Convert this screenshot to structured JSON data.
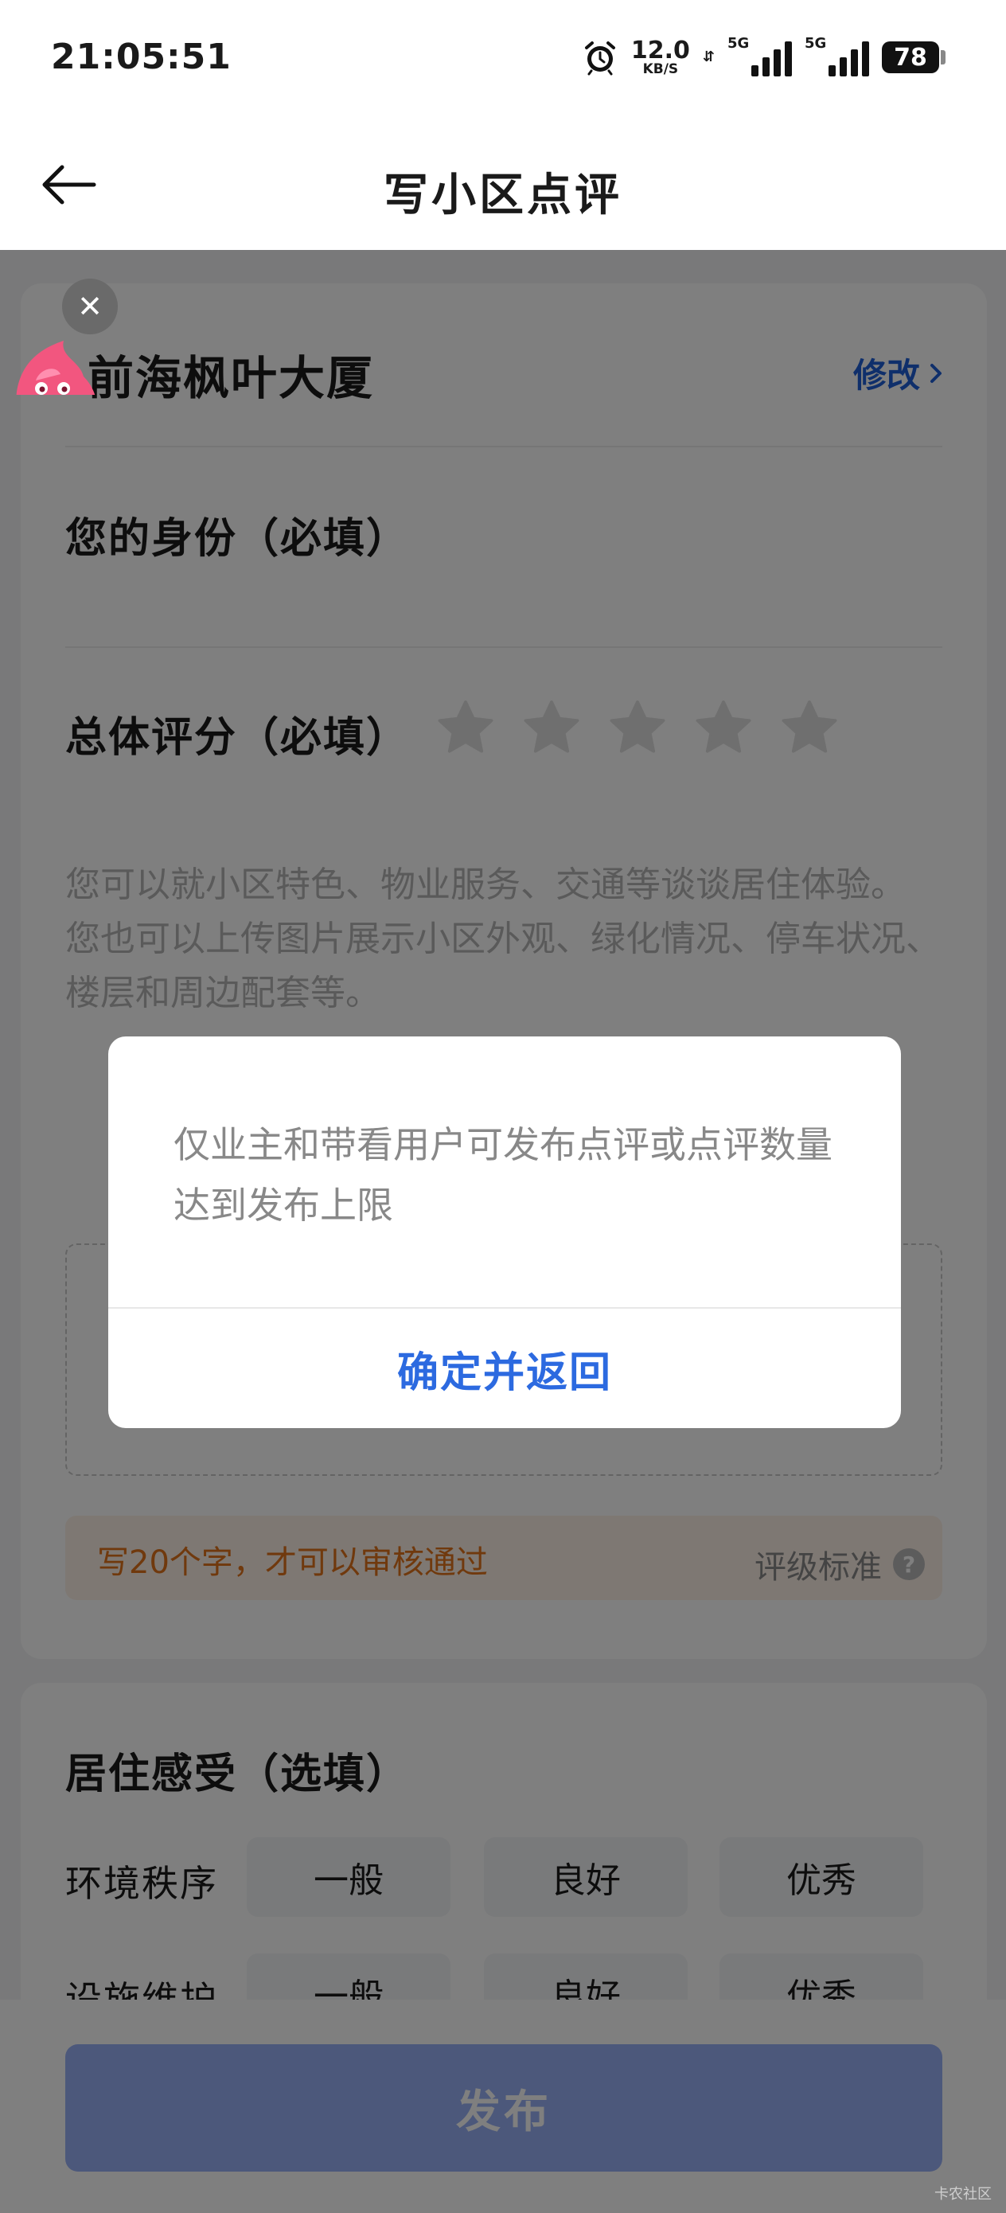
{
  "status_bar": {
    "time": "21:05:51",
    "net_speed_value": "12.0",
    "net_speed_unit": "KB/S",
    "signal1_label": "5G",
    "signal2_label": "5G",
    "battery": "78"
  },
  "nav": {
    "title": "写小区点评"
  },
  "community": {
    "name": "前海枫叶大厦",
    "modify": "修改"
  },
  "identity": {
    "title": "您的身份（必填）"
  },
  "rating": {
    "title": "总体评分（必填）",
    "stars_selected": 0,
    "stars_total": 5
  },
  "review": {
    "placeholder_line1": "您可以就小区特色、物业服务、交通等谈谈居住体验。",
    "placeholder_line2": "您也可以上传图片展示小区外观、绿化情况、停车状况、楼层和周边配套等。"
  },
  "tip": {
    "text": "写20个字，才可以审核通过",
    "rating_standard": "评级标准",
    "help_glyph": "?"
  },
  "living_feel": {
    "title": "居住感受（选填）",
    "rows": [
      {
        "label": "环境秩序",
        "options": [
          "一般",
          "良好",
          "优秀"
        ]
      },
      {
        "label": "设施维护",
        "options": [
          "一般",
          "良好",
          "优秀"
        ]
      }
    ]
  },
  "bottom": {
    "publish": "发布"
  },
  "dialog": {
    "message": "仅业主和带看用户可发布点评或点评数量达到发布上限",
    "confirm": "确定并返回"
  },
  "float_close_glyph": "✕",
  "watermark": "卡农社区",
  "colors": {
    "accent": "#2c6ae0",
    "link": "#1f5fd6",
    "tip_text": "#e0731a",
    "publish_disabled": "#99b1f7",
    "star_empty": "#dedede"
  },
  "icons": [
    "back-arrow-icon",
    "alarm-icon",
    "star-icon",
    "chevron-right-icon",
    "help-icon",
    "close-icon",
    "mascot-icon"
  ]
}
